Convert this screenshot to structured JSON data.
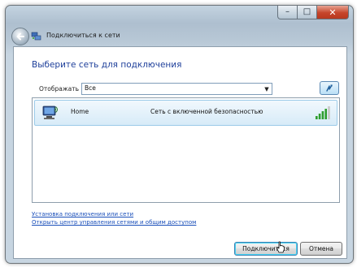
{
  "window": {
    "title": "Подключиться к сети",
    "controls": {
      "minimize": "–",
      "maximize": "□",
      "close": "✕"
    }
  },
  "main": {
    "heading": "Выберите сеть для подключения",
    "filter": {
      "label": "Отображать",
      "selected": "Все"
    },
    "networks": [
      {
        "name": "Home",
        "security": "Сеть с включенной безопасностью",
        "signal_bars_lit": 4,
        "signal_bars_total": 5
      }
    ]
  },
  "links": [
    {
      "label": "Установка подключения или сети"
    },
    {
      "label": "Открыть центр управления сетями и общим доступом"
    }
  ],
  "buttons": {
    "connect": "Подключиться",
    "cancel": "Отмена"
  },
  "icons": {
    "back": "back-arrow-icon",
    "title": "network-icon",
    "refresh": "refresh-icon",
    "network": "wireless-computer-icon",
    "signal": "signal-strength-icon"
  },
  "colors": {
    "heading": "#1e3f9a",
    "link": "#1a4fba",
    "signal": "#2e9e2e",
    "selection": "#d7ebf8"
  }
}
